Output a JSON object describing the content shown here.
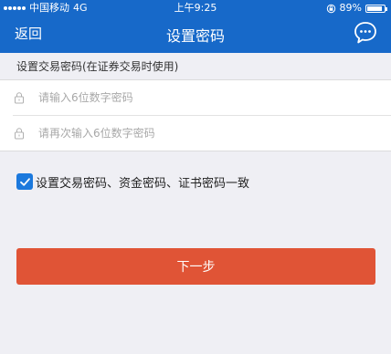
{
  "status_bar": {
    "carrier": "中国移动",
    "network": "4G",
    "time": "上午9:25",
    "battery": "89%",
    "battery_level": 0.89
  },
  "nav": {
    "back_label": "返回",
    "title": "设置密码",
    "chat_icon": "chat-bubble-icon"
  },
  "section": {
    "header": "设置交易密码(在证券交易时使用)"
  },
  "form": {
    "password_placeholder": "请输入6位数字密码",
    "confirm_placeholder": "请再次输入6位数字密码",
    "lock_icon": "lock-icon"
  },
  "sync_option": {
    "checked": true,
    "label": "设置交易密码、资金密码、证书密码一致"
  },
  "actions": {
    "next_label": "下一步"
  },
  "colors": {
    "header_bg": "#1769c9",
    "page_bg": "#efeff4",
    "button_bg": "#e05436",
    "checkbox_bg": "#1c79dd"
  }
}
